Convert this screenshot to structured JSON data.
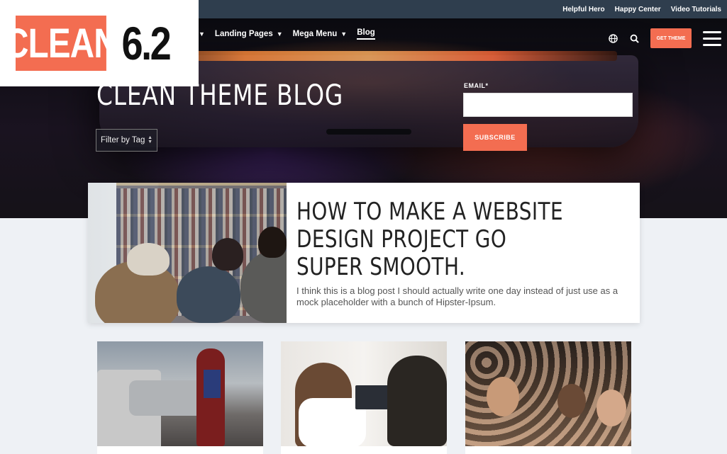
{
  "topbar": {
    "links": [
      "Helpful Hero",
      "Happy Center",
      "Video Tutorials"
    ]
  },
  "logo": {
    "word": "CLEAN",
    "version": "6.2"
  },
  "nav": {
    "items": [
      {
        "label": "Landing Pages",
        "has_dropdown": true
      },
      {
        "label": "Mega Menu",
        "has_dropdown": true
      },
      {
        "label": "Blog",
        "active": true
      }
    ],
    "get_theme_label": "GET THEME",
    "icons": [
      "globe-icon",
      "search-icon",
      "hamburger-menu-icon"
    ]
  },
  "hero": {
    "title": "CLEAN THEME BLOG",
    "filter_label": "Filter by Tag",
    "email_label": "EMAIL*",
    "email_value": "",
    "subscribe_label": "SUBSCRIBE"
  },
  "featured": {
    "title": "HOW TO MAKE A WEBSITE DESIGN PROJECT GO SUPER SMOOTH.",
    "excerpt": "I think this is a blog post I should actually write one day instead of just use as a mock placeholder with a bunch of Hipster-Ipsum."
  },
  "colors": {
    "accent": "#f36d51",
    "topbar": "#2f3e4e",
    "page_bg": "#eef1f5"
  }
}
